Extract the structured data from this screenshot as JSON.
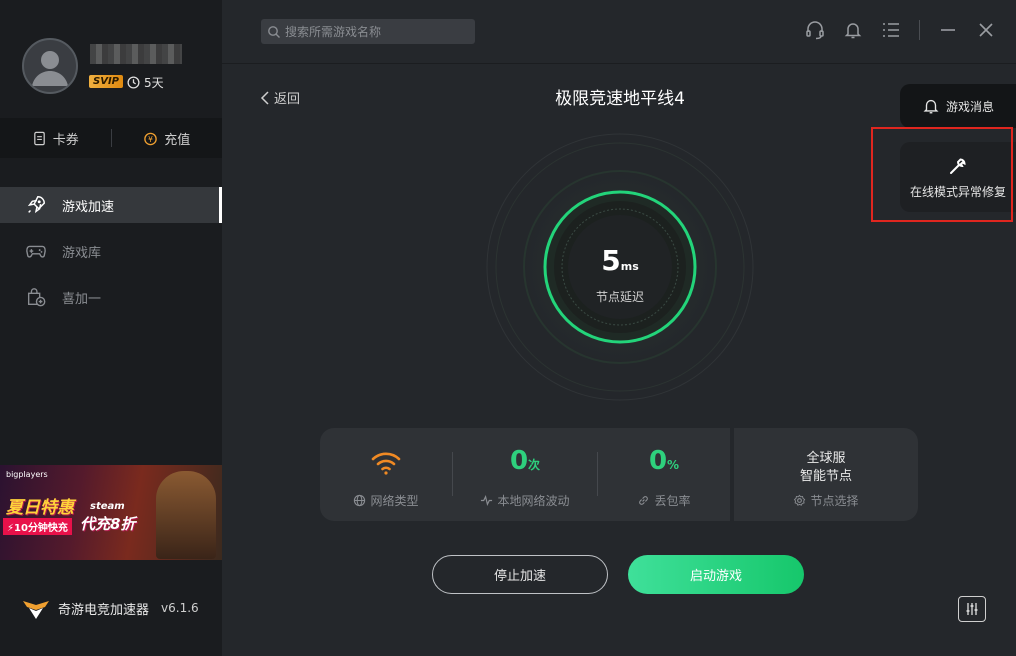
{
  "user": {
    "badge": "SVIP",
    "days": "5天"
  },
  "quick": {
    "coupon": "卡券",
    "recharge": "充值"
  },
  "nav": [
    {
      "label": "游戏加速",
      "icon": "rocket-icon",
      "active": true
    },
    {
      "label": "游戏库",
      "icon": "gamepad-icon",
      "active": false
    },
    {
      "label": "喜加一",
      "icon": "gift-bag-icon",
      "active": false
    }
  ],
  "banner": {
    "brand": "bigplayers",
    "headline": "夏日特惠",
    "platform": "steam",
    "offer": "代充8折",
    "tag": "⚡10分钟快充"
  },
  "app": {
    "name": "奇游电竞加速器",
    "version": "v6.1.6"
  },
  "search": {
    "placeholder": "搜索所需游戏名称"
  },
  "main": {
    "back": "返回",
    "title": "极限竞速地平线4",
    "ping_value": "5",
    "ping_unit": "ms",
    "ping_label": "节点延迟"
  },
  "stats": {
    "network_type_label": "网络类型",
    "fluctuation_value": "0",
    "fluctuation_unit": "次",
    "fluctuation_label": "本地网络波动",
    "loss_value": "0",
    "loss_unit": "%",
    "loss_label": "丢包率",
    "server_line1": "全球服",
    "server_line2": "智能节点",
    "node_select_label": "节点选择"
  },
  "buttons": {
    "stop": "停止加速",
    "start": "启动游戏"
  },
  "side": {
    "messages": "游戏消息",
    "repair": "在线模式异常修复"
  },
  "colors": {
    "accent": "#2ed07d",
    "wifi": "#f08a24",
    "highlight": "#e0261f"
  }
}
